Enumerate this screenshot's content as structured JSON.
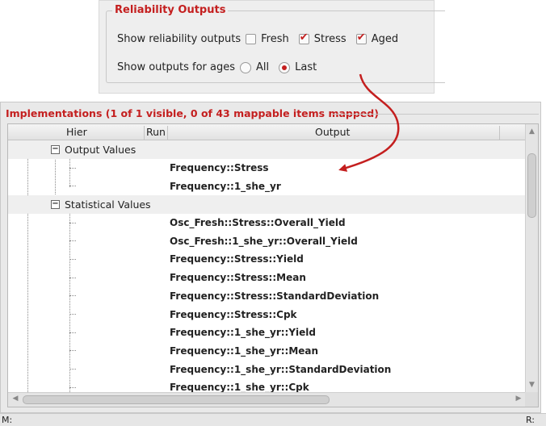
{
  "reliability": {
    "title": "Reliability Outputs",
    "show_outputs_label": "Show reliability outputs",
    "options": [
      {
        "label": "Fresh",
        "checked": false
      },
      {
        "label": "Stress",
        "checked": true
      },
      {
        "label": "Aged",
        "checked": true
      }
    ],
    "ages_label": "Show outputs for ages",
    "ages": [
      {
        "label": "All",
        "selected": false
      },
      {
        "label": "Last",
        "selected": true
      }
    ]
  },
  "implementations": {
    "title": "Implementations (1 of 1 visible, 0 of 43 mappable items mapped)",
    "columns": [
      "Hier",
      "Run",
      "Output"
    ],
    "groups": [
      {
        "name": "Output Values",
        "items": [
          "Frequency::Stress",
          "Frequency::1_she_yr"
        ]
      },
      {
        "name": "Statistical Values",
        "items": [
          "Osc_Fresh::Stress::Overall_Yield",
          "Osc_Fresh::1_she_yr::Overall_Yield",
          "Frequency::Stress::Yield",
          "Frequency::Stress::Mean",
          "Frequency::Stress::StandardDeviation",
          "Frequency::Stress::Cpk",
          "Frequency::1_she_yr::Yield",
          "Frequency::1_she_yr::Mean",
          "Frequency::1_she_yr::StandardDeviation",
          "Frequency::1_she_yr::Cpk"
        ]
      }
    ]
  },
  "status": {
    "left": "M:",
    "right": "R:"
  },
  "colors": {
    "accent": "#c41f1f"
  }
}
